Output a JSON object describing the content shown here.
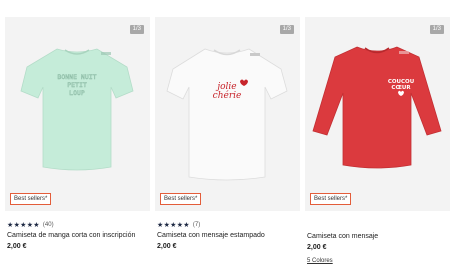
{
  "products": [
    {
      "counter": "1/3",
      "badge": "Best sellers*",
      "stars": "★★★★★",
      "reviews": "(40)",
      "title": "Camiseta de manga corta con inscripción",
      "price": "2,00 €",
      "image_text": "bonne nuit petit",
      "shirt_color": "#c5ecd9"
    },
    {
      "counter": "1/3",
      "badge": "Best sellers*",
      "stars": "★★★★★",
      "reviews": "(7)",
      "title": "Camiseta con mensaje estampado",
      "price": "2,00 €",
      "image_text": "jolie chérie",
      "shirt_color": "#fafafa"
    },
    {
      "counter": "1/3",
      "badge": "Best sellers*",
      "title": "Camiseta con mensaje",
      "price": "2,00 €",
      "colors": "5 Colores",
      "image_text": "coucou cœur",
      "shirt_color": "#db3a3e"
    }
  ],
  "accent": "#e35d3a"
}
